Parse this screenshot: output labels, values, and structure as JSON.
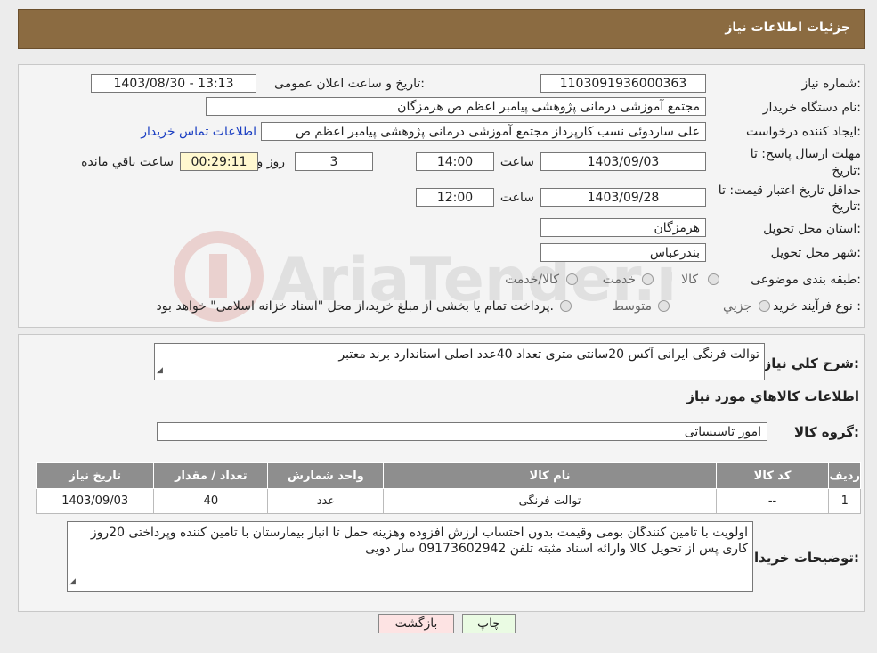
{
  "header": {
    "title": "جزئیات اطلاعات نیاز"
  },
  "watermark": {
    "text": "AriaTender.neT"
  },
  "info": {
    "need_number_label": "شماره نیاز:",
    "need_number": "1103091936000363",
    "announce_label": "تاریخ و ساعت اعلان عمومی:",
    "announce_value": "1403/08/30 - 13:13",
    "buyer_org_label": "نام دستگاه خریدار:",
    "buyer_org": "مجتمع آموزشی درمانی پژوهشی پیامبر اعظم ص  هرمزگان",
    "creator_label": "ایجاد کننده درخواست:",
    "creator": "علی ساردوئی نسب کارپرداز مجتمع آموزشی درمانی پژوهشی پیامبر اعظم ص",
    "contact_link": "اطلاعات تماس خریدار",
    "deadline_label_1": "مهلت ارسال پاسخ: تا",
    "deadline_label_2": "تاریخ:",
    "deadline_date": "1403/09/03",
    "time_label": "ساعت",
    "deadline_time": "14:00",
    "days_value": "3",
    "days_label": "روز و",
    "remaining_value": "00:29:11",
    "remaining_label": "ساعت باقي مانده",
    "validity_label_1": "حداقل تاریخ اعتبار قیمت: تا",
    "validity_label_2": "تاریخ:",
    "validity_date": "1403/09/28",
    "validity_time_label": "ساعت",
    "validity_time": "12:00",
    "province_label": "استان محل تحویل:",
    "province": "هرمزگان",
    "city_label": "شهر محل تحویل:",
    "city": "بندرعباس",
    "category_label": "طبقه بندی موضوعی:",
    "category_options": [
      "کالا",
      "خدمت",
      "کالا/خدمت"
    ],
    "process_label": "نوع فرآیند خرید :",
    "process_options": [
      "جزیي",
      "متوسط"
    ],
    "process_note": "پرداخت تمام یا بخشی از مبلغ خرید،از محل \"اسناد خزانه اسلامی\" خواهد بود."
  },
  "details": {
    "summary_label": "شرح کلي نياز:",
    "summary": "توالت فرنگی ایرانی آکس  20سانتی  متری تعداد  40عدد  اصلی  استاندارد برند  معتبر",
    "goods_title": "اطلاعات کالاهاي مورد نياز",
    "group_label": "گروه کالا:",
    "group_value": "امور تاسیساتی",
    "table": {
      "headers": [
        "رديف",
        "کد کالا",
        "نام کالا",
        "واحد شمارش",
        "تعداد / مقدار",
        "تاریخ نیاز"
      ],
      "rows": [
        [
          "1",
          "--",
          "توالت فرنگی",
          "عدد",
          "40",
          "1403/09/03"
        ]
      ]
    },
    "buyer_notes_label": "توضیحات خریدار:",
    "buyer_notes": "اولویت  با تامین  کنندگان بومی  وقیمت  بدون  احتساب  ارزش  افزوده  وهزینه  حمل  تا انبار  بیمارستان  با  تامین  کننده  وپرداختی 20روز کاری  پس  از تحویل  کالا  وارائه  اسناد مثبته  تلفن  09173602942 سار دویی"
  },
  "buttons": {
    "print": "چاپ",
    "back": "بازگشت"
  }
}
